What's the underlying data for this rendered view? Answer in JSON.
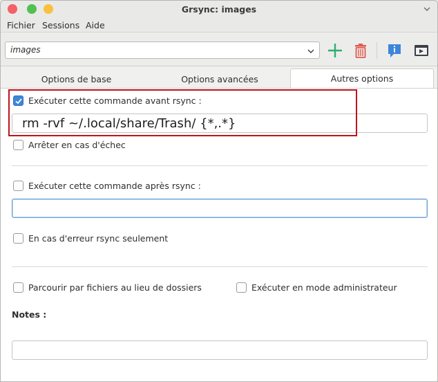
{
  "window": {
    "title": "Grsync: images"
  },
  "menubar": {
    "items": [
      "Fichier",
      "Sessions",
      "Aide"
    ]
  },
  "toolbar": {
    "session_value": "images"
  },
  "tabs": [
    {
      "label": "Options de base"
    },
    {
      "label": "Options avancées"
    },
    {
      "label": "Autres options",
      "active": true
    }
  ],
  "options": {
    "pre_command": {
      "label": "Exécuter cette commande avant rsync :",
      "checked": true,
      "value": "rm -rvf ~/.local/share/Trash/ {*,.*}"
    },
    "stop_on_fail": {
      "label": "Arrêter en cas d'échec",
      "checked": false
    },
    "post_command": {
      "label": "Exécuter cette commande après rsync :",
      "checked": false,
      "value": ""
    },
    "on_error_only": {
      "label": "En cas d'erreur rsync seulement",
      "checked": false
    },
    "browse_files": {
      "label": "Parcourir par fichiers au lieu de dossiers",
      "checked": false
    },
    "run_as_admin": {
      "label": "Exécuter en mode administrateur",
      "checked": false
    },
    "notes": {
      "label": "Notes :",
      "value": ""
    }
  },
  "colors": {
    "accent": "#3d86d9",
    "add": "#2fae6f",
    "delete": "#e0594f",
    "highlight": "#c1121c"
  },
  "icons": [
    "add-session-icon",
    "delete-session-icon",
    "info-icon",
    "execute-icon",
    "chevron-down-icon",
    "checkmark-icon"
  ]
}
